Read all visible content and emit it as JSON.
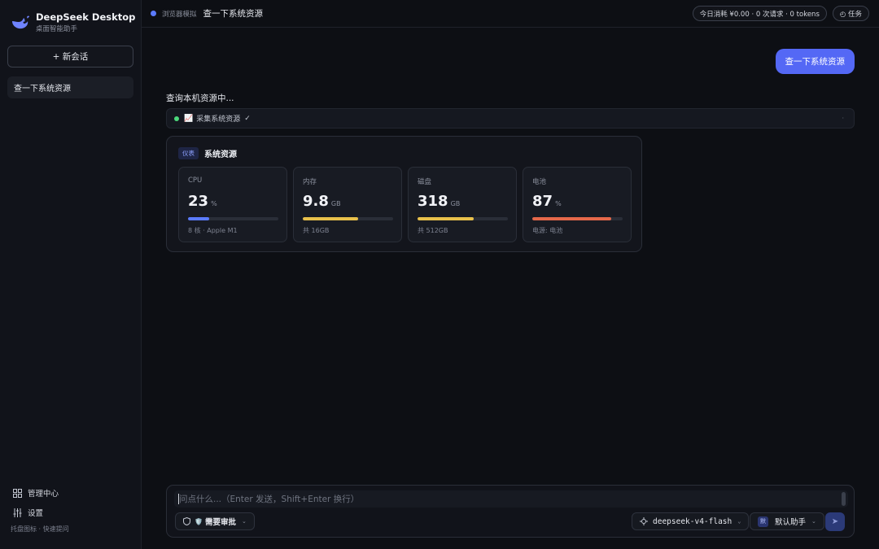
{
  "brand": {
    "title": "DeepSeek Desktop",
    "subtitle": "桌面智能助手",
    "accent": "#6f83ff"
  },
  "sidebar": {
    "new_chat_label": "+ 新会话",
    "conversations": [
      {
        "label": "查一下系统资源"
      }
    ],
    "links": [
      {
        "icon": "grid-icon",
        "label": "管理中心"
      },
      {
        "icon": "sliders-icon",
        "label": "设置"
      }
    ],
    "hint": "托盘图标 · 快速提问"
  },
  "header": {
    "mode": "浏览器模拟",
    "title": "查一下系统资源",
    "usage": "今日消耗 ¥0.00 · 0 次请求 · 0 tokens",
    "tasks": "◴ 任务"
  },
  "chat": {
    "user_message": "查一下系统资源",
    "assistant_text": "查询本机资源中...",
    "tool": {
      "icon": "📈",
      "label": "采集系统资源",
      "status": "✓",
      "more": "·"
    },
    "dashboard": {
      "badge": "仪表",
      "title": "系统资源",
      "cards": [
        {
          "label": "CPU",
          "value": "23",
          "unit": "%",
          "level": 0.23,
          "color": "#5b7bff",
          "note": "8 核 · Apple M1"
        },
        {
          "label": "内存",
          "value": "9.8",
          "unit": "GB",
          "level": 0.61,
          "color": "#e9c14b",
          "note": "共 16GB"
        },
        {
          "label": "磁盘",
          "value": "318",
          "unit": "GB",
          "level": 0.62,
          "color": "#e9c14b",
          "note": "共 512GB"
        },
        {
          "label": "电池",
          "value": "87",
          "unit": "%",
          "level": 0.87,
          "color": "#e5684a",
          "note": "电源: 电池"
        }
      ]
    }
  },
  "composer": {
    "placeholder": "问点什么...（Enter 发送，Shift+Enter 换行）",
    "approval_label": "需要审批",
    "approval_icon": "🛡️",
    "model": "deepseek-v4-flash",
    "assistant_badge": "默",
    "assistant_label": "默认助手",
    "send_icon": "➤"
  }
}
